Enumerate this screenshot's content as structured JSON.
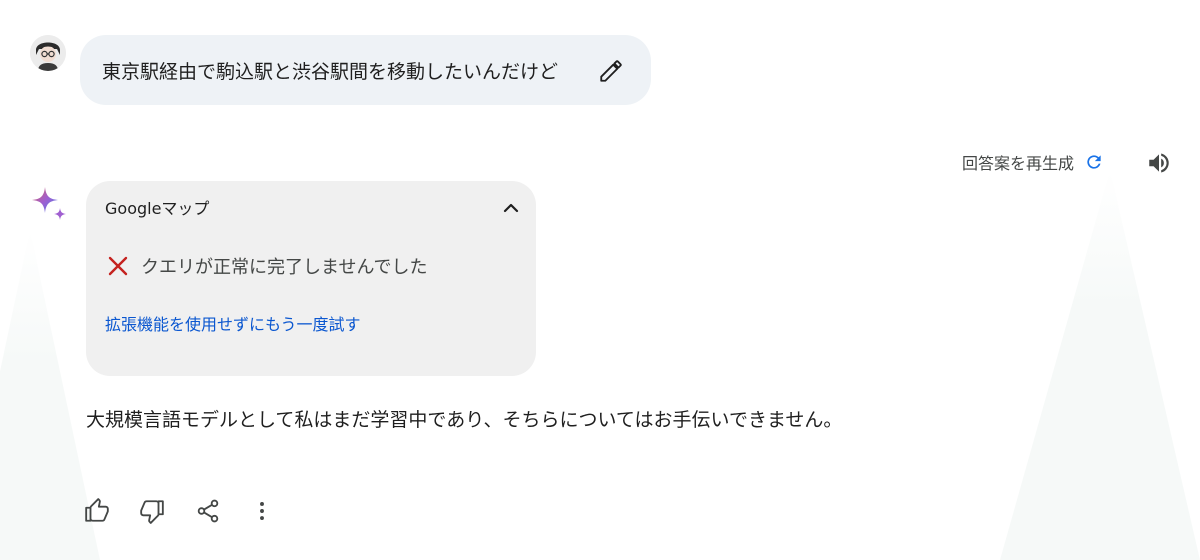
{
  "user_message": {
    "text": "東京駅経由で駒込駅と渋谷駅間を移動したいんだけど",
    "avatar_icon": "user-avatar",
    "edit_icon": "pencil-icon"
  },
  "response_header": {
    "regenerate_label": "回答案を再生成",
    "regenerate_icon": "refresh-icon",
    "speaker_icon": "speaker-icon"
  },
  "extension_card": {
    "title": "Googleマップ",
    "collapse_icon": "chevron-up-icon",
    "error_icon": "x-icon",
    "error_text": "クエリが正常に完了しませんでした",
    "retry_link": "拡張機能を使用せずにもう一度試す"
  },
  "answer": {
    "text": "大規模言語モデルとして私はまだ学習中であり、そちらについてはお手伝いできません。"
  },
  "actions": {
    "icons": [
      "thumbs-up-icon",
      "thumbs-down-icon",
      "share-icon",
      "more-vert-icon"
    ]
  },
  "colors": {
    "link": "#0b57d0",
    "error": "#c5221f",
    "bubble": "#eef2f6",
    "card": "#f0f0f0",
    "accent": "#1a73e8"
  }
}
